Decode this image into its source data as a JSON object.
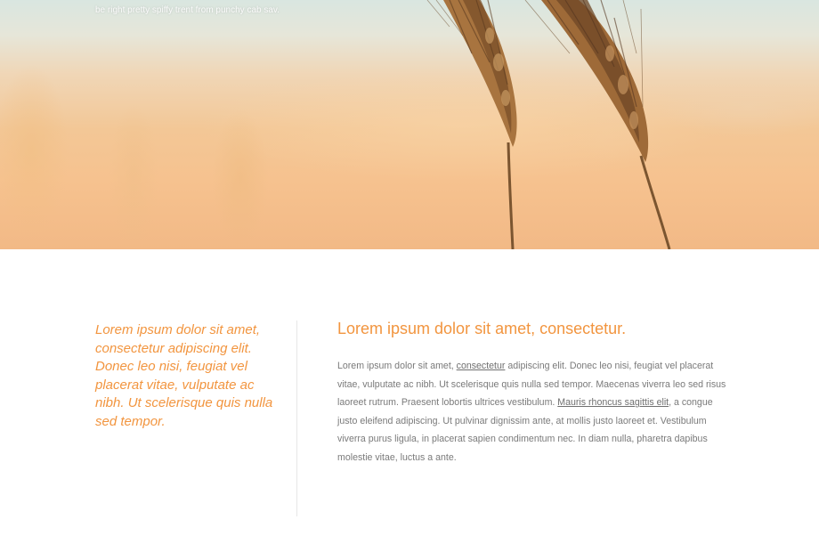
{
  "hero": {
    "caption": "be right pretty spiffy trent from punchy cab sav."
  },
  "content": {
    "pull_quote": "Lorem ipsum dolor sit amet, consectetur adipiscing elit. Donec leo nisi, feugiat vel placerat vitae, vulputate ac nibh. Ut scelerisque quis nulla sed tempor.",
    "title": "Lorem ipsum dolor sit amet, consectetur.",
    "body": {
      "part1": "Lorem ipsum dolor sit amet, ",
      "link1": "consectetur",
      "part2": " adipiscing elit. Donec leo nisi, feugiat vel placerat vitae, vulputate ac nibh. Ut scelerisque quis nulla sed tempor. Maecenas viverra leo sed risus laoreet rutrum. Praesent lobortis ultrices vestibulum. ",
      "link2": "Mauris rhoncus sagittis elit",
      "part3": ", a congue justo eleifend adipiscing. Ut pulvinar dignissim ante, at mollis justo laoreet et. Vestibulum viverra purus ligula, in placerat sapien condimentum nec. In diam nulla, pharetra dapibus molestie vitae, luctus a ante."
    }
  },
  "colors": {
    "accent": "#f2953f",
    "body_text": "#7a7a7a",
    "divider": "#e7e7e7"
  }
}
